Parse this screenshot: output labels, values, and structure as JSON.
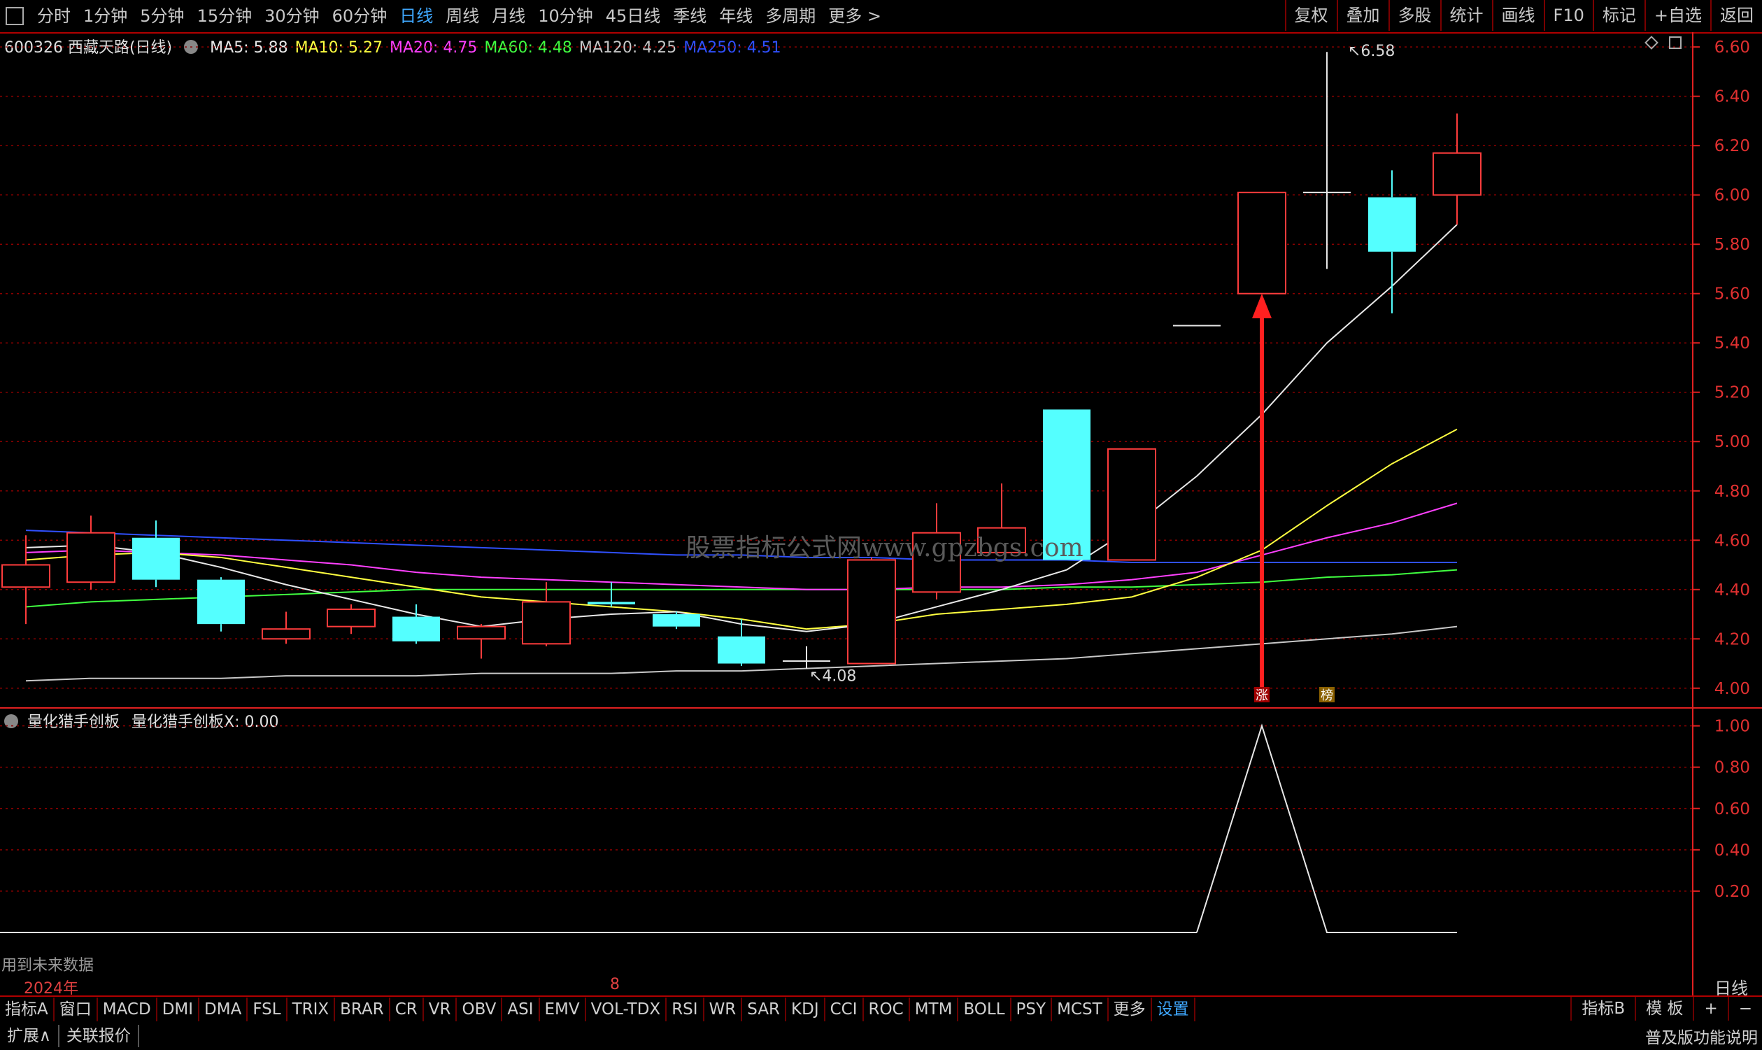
{
  "toolbar": {
    "periods": [
      "分时",
      "1分钟",
      "5分钟",
      "15分钟",
      "30分钟",
      "60分钟",
      "日线",
      "周线",
      "月线",
      "10分钟",
      "45日线",
      "季线",
      "年线",
      "多周期",
      "更多 >"
    ],
    "active_period": "日线",
    "right_tools": [
      "复权",
      "叠加",
      "多股",
      "统计",
      "画线",
      "F10",
      "标记",
      "+自选",
      "返回"
    ]
  },
  "stock": {
    "code_name": "600326 西藏天路(日线)",
    "ma": [
      {
        "label": "MA5: 5.88",
        "color": "#e8e8e8"
      },
      {
        "label": "MA10: 5.27",
        "color": "#ffff40"
      },
      {
        "label": "MA20: 4.75",
        "color": "#ff40ff"
      },
      {
        "label": "MA60: 4.48",
        "color": "#40ff40"
      },
      {
        "label": "MA120: 4.25",
        "color": "#c8c8c8"
      },
      {
        "label": "MA250: 4.51",
        "color": "#3050ff"
      }
    ]
  },
  "indicator": {
    "name": "量化猎手创板",
    "value_label": "量化猎手创板X: 0.00"
  },
  "watermark": "股票指标公式网www.gpzbgs.com",
  "future_note": "用到未来数据",
  "dates": {
    "left": "2024年",
    "mid": "8"
  },
  "period_label": "日线",
  "annotations": {
    "high": "6.58",
    "low": "4.08",
    "marker_zhang": "涨",
    "marker_bang": "榜"
  },
  "colors": {
    "up": "#ff3c3c",
    "down": "#54ffff",
    "grid": "#8b0000",
    "axis": "#e02020"
  },
  "chart_data": {
    "type": "candlestick",
    "price_axis_ticks": [
      "6.60",
      "6.40",
      "6.20",
      "6.00",
      "5.80",
      "5.60",
      "5.40",
      "5.20",
      "5.00",
      "4.80",
      "4.60",
      "4.40",
      "4.20",
      "4.00"
    ],
    "price_range": [
      3.92,
      6.66
    ],
    "indicator_axis_ticks": [
      "1.00",
      "0.80",
      "0.60",
      "0.40",
      "0.20"
    ],
    "indicator_range": [
      -0.2,
      1.08
    ],
    "candles": [
      {
        "o": 4.41,
        "h": 4.62,
        "l": 4.26,
        "c": 4.5
      },
      {
        "o": 4.43,
        "h": 4.7,
        "l": 4.4,
        "c": 4.63
      },
      {
        "o": 4.61,
        "h": 4.68,
        "l": 4.41,
        "c": 4.44
      },
      {
        "o": 4.44,
        "h": 4.45,
        "l": 4.23,
        "c": 4.26
      },
      {
        "o": 4.2,
        "h": 4.31,
        "l": 4.18,
        "c": 4.24
      },
      {
        "o": 4.25,
        "h": 4.34,
        "l": 4.22,
        "c": 4.32
      },
      {
        "o": 4.29,
        "h": 4.34,
        "l": 4.18,
        "c": 4.19
      },
      {
        "o": 4.2,
        "h": 4.26,
        "l": 4.12,
        "c": 4.25
      },
      {
        "o": 4.18,
        "h": 4.43,
        "l": 4.17,
        "c": 4.35
      },
      {
        "o": 4.35,
        "h": 4.43,
        "l": 4.33,
        "c": 4.34
      },
      {
        "o": 4.3,
        "h": 4.31,
        "l": 4.24,
        "c": 4.25
      },
      {
        "o": 4.21,
        "h": 4.28,
        "l": 4.09,
        "c": 4.1
      },
      {
        "o": 4.11,
        "h": 4.17,
        "l": 4.08,
        "c": 4.11
      },
      {
        "o": 4.1,
        "h": 4.53,
        "l": 4.1,
        "c": 4.52
      },
      {
        "o": 4.39,
        "h": 4.75,
        "l": 4.36,
        "c": 4.63
      },
      {
        "o": 4.55,
        "h": 4.83,
        "l": 4.55,
        "c": 4.65
      },
      {
        "o": 5.13,
        "h": 5.13,
        "l": 4.52,
        "c": 4.52
      },
      {
        "o": 4.52,
        "h": 4.97,
        "l": 4.52,
        "c": 4.97
      },
      {
        "o": 5.47,
        "h": 5.47,
        "l": 5.47,
        "c": 5.47
      },
      {
        "o": 5.6,
        "h": 6.01,
        "l": 5.6,
        "c": 6.01
      },
      {
        "o": 6.01,
        "h": 6.58,
        "l": 5.7,
        "c": 6.01
      },
      {
        "o": 5.99,
        "h": 6.1,
        "l": 5.52,
        "c": 5.77
      },
      {
        "o": 6.0,
        "h": 6.33,
        "l": 5.88,
        "c": 6.17
      }
    ],
    "ma5": [
      4.57,
      4.58,
      4.55,
      4.49,
      4.42,
      4.36,
      4.3,
      4.25,
      4.28,
      4.3,
      4.31,
      4.26,
      4.23,
      4.26,
      4.33,
      4.4,
      4.48,
      4.65,
      4.86,
      5.11,
      5.4,
      5.63,
      5.88
    ],
    "ma10": [
      4.52,
      4.54,
      4.55,
      4.53,
      4.49,
      4.45,
      4.41,
      4.37,
      4.35,
      4.33,
      4.31,
      4.28,
      4.24,
      4.26,
      4.3,
      4.32,
      4.34,
      4.37,
      4.45,
      4.56,
      4.74,
      4.91,
      5.05,
      5.27
    ],
    "ma20": [
      4.55,
      4.56,
      4.55,
      4.54,
      4.52,
      4.5,
      4.47,
      4.45,
      4.44,
      4.43,
      4.42,
      4.41,
      4.4,
      4.4,
      4.41,
      4.41,
      4.42,
      4.44,
      4.47,
      4.54,
      4.61,
      4.67,
      4.75
    ],
    "ma60": [
      4.33,
      4.35,
      4.36,
      4.37,
      4.38,
      4.39,
      4.4,
      4.4,
      4.4,
      4.4,
      4.4,
      4.4,
      4.4,
      4.4,
      4.4,
      4.4,
      4.41,
      4.41,
      4.42,
      4.43,
      4.45,
      4.46,
      4.48
    ],
    "ma120": [
      4.03,
      4.04,
      4.04,
      4.04,
      4.05,
      4.05,
      4.05,
      4.06,
      4.06,
      4.06,
      4.07,
      4.07,
      4.08,
      4.09,
      4.1,
      4.11,
      4.12,
      4.14,
      4.16,
      4.18,
      4.2,
      4.22,
      4.25
    ],
    "ma250": [
      4.64,
      4.63,
      4.62,
      4.61,
      4.6,
      4.59,
      4.58,
      4.57,
      4.56,
      4.55,
      4.54,
      4.54,
      4.53,
      4.53,
      4.52,
      4.52,
      4.52,
      4.51,
      4.51,
      4.51,
      4.51,
      4.51,
      4.51
    ],
    "indicator_values": [
      0,
      0,
      0,
      0,
      0,
      0,
      0,
      0,
      0,
      0,
      0,
      0,
      0,
      0,
      0,
      0,
      0,
      0,
      0,
      1,
      0,
      0,
      0
    ]
  }
}
